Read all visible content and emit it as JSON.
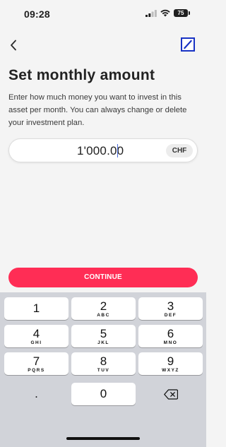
{
  "status_bar": {
    "time": "09:28",
    "battery": "75",
    "signal_icon": "signal-bars-icon",
    "wifi_icon": "wifi-icon",
    "battery_icon": "battery-icon"
  },
  "nav": {
    "back_icon": "chevron-left-icon",
    "logo_icon": "deutsche-bank-logo"
  },
  "title": "Set monthly amount",
  "description": "Enter how much money you want to invest in this asset per month. You can always change or delete your investment plan.",
  "amount": {
    "value": "1'000.00",
    "currency": "CHF"
  },
  "continue_label": "CONTINUE",
  "keyboard": {
    "keys": [
      {
        "digit": "1",
        "letters": ""
      },
      {
        "digit": "2",
        "letters": "ABC"
      },
      {
        "digit": "3",
        "letters": "DEF"
      },
      {
        "digit": "4",
        "letters": "GHI"
      },
      {
        "digit": "5",
        "letters": "JKL"
      },
      {
        "digit": "6",
        "letters": "MNO"
      },
      {
        "digit": "7",
        "letters": "PQRS"
      },
      {
        "digit": "8",
        "letters": "TUV"
      },
      {
        "digit": "9",
        "letters": "WXYZ"
      },
      {
        "digit": "0",
        "letters": ""
      }
    ],
    "decimal_key": ".",
    "delete_icon": "backspace-icon"
  },
  "colors": {
    "accent": "#ff2d55",
    "logo_blue": "#1832c4",
    "background": "#f4f4f4",
    "keyboard_bg": "#d1d3d9"
  }
}
